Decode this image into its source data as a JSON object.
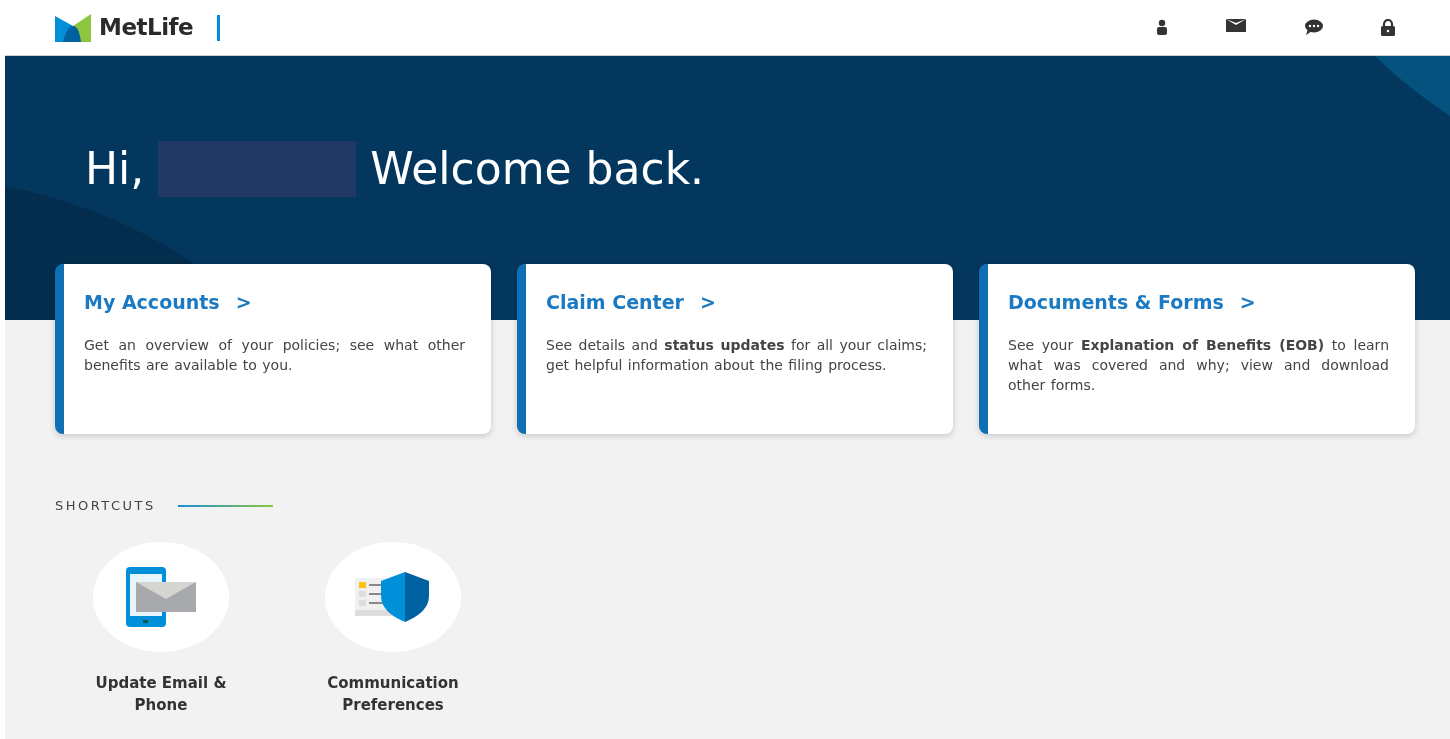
{
  "header": {
    "brand": "MetLife"
  },
  "hero": {
    "greeting": "Hi,",
    "welcome": "Welcome back."
  },
  "cards": [
    {
      "title": "My Accounts",
      "arrow": ">",
      "description": "Get an overview of your policies; see what other benefits are available to you."
    },
    {
      "title": "Claim Center",
      "arrow": ">",
      "description": "See details and **status updates** for all your claims; get helpful information about the filing process."
    },
    {
      "title": "Documents & Forms",
      "arrow": ">",
      "description": "See your **Explanation of Benefits (EOB)** to learn what was covered and why; view and download other forms."
    }
  ],
  "shortcuts": {
    "heading": "SHORTCUTS",
    "items": [
      {
        "kind": "phone-mail",
        "label": "Update Email & Phone"
      },
      {
        "kind": "shield",
        "label": "Communication Preferences"
      }
    ]
  }
}
